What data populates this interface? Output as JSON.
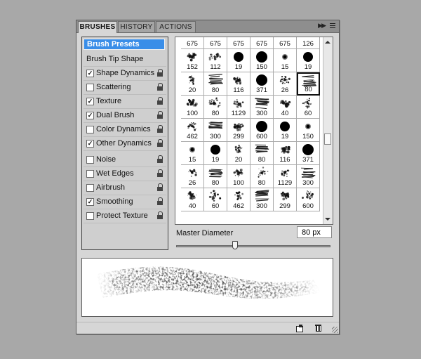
{
  "tabs": [
    {
      "label": "BRUSHES",
      "active": true
    },
    {
      "label": "HISTORY",
      "active": false
    },
    {
      "label": "ACTIONS",
      "active": false
    }
  ],
  "tab_controls": {
    "collapse_icon": "double-arrow-icon",
    "menu_icon": "panel-menu-icon"
  },
  "sidebar": {
    "preset_button": "Brush Presets",
    "tip_shape": "Brush Tip Shape",
    "options": [
      {
        "label": "Shape Dynamics",
        "checked": true,
        "locked": true
      },
      {
        "label": "Scattering",
        "checked": false,
        "locked": true
      },
      {
        "label": "Texture",
        "checked": true,
        "locked": true
      },
      {
        "label": "Dual Brush",
        "checked": true,
        "locked": true
      },
      {
        "label": "Color Dynamics",
        "checked": false,
        "locked": true
      },
      {
        "label": "Other Dynamics",
        "checked": true,
        "locked": true
      },
      {
        "label": "Noise",
        "checked": false,
        "locked": true
      },
      {
        "label": "Wet Edges",
        "checked": false,
        "locked": true
      },
      {
        "label": "Airbrush",
        "checked": false,
        "locked": true
      },
      {
        "label": "Smoothing",
        "checked": true,
        "locked": true
      },
      {
        "label": "Protect Texture",
        "checked": false,
        "locked": true
      }
    ]
  },
  "brush_grid": {
    "selected_index": 17,
    "sizes": [
      "675",
      "675",
      "675",
      "675",
      "675",
      "126",
      "152",
      "112",
      "19",
      "150",
      "15",
      "19",
      "20",
      "80",
      "116",
      "371",
      "26",
      "80",
      "100",
      "80",
      "1129",
      "300",
      "40",
      "60",
      "462",
      "300",
      "299",
      "600",
      "19",
      "150",
      "15",
      "19",
      "20",
      "80",
      "116",
      "371",
      "26",
      "80",
      "100",
      "80",
      "1129",
      "300",
      "40",
      "60",
      "462",
      "300",
      "299",
      "600"
    ],
    "styles": [
      "x",
      "x",
      "x",
      "x",
      "x",
      "x",
      "x",
      "x",
      "hard",
      "hard",
      "soft",
      "hard",
      "x",
      "x",
      "x",
      "hard",
      "x",
      "x",
      "x",
      "x",
      "x",
      "x",
      "x",
      "x",
      "x",
      "x",
      "x",
      "hard",
      "hard",
      "soft",
      "soft",
      "hard",
      "x",
      "x",
      "x",
      "hard",
      "x",
      "x",
      "x",
      "x",
      "x",
      "x",
      "x",
      "x",
      "x",
      "x",
      "x",
      "x"
    ]
  },
  "master_diameter": {
    "label": "Master Diameter",
    "value": "80 px",
    "slider_fraction": 0.38
  },
  "bottom_icons": [
    "new-preset-icon",
    "trash-icon"
  ]
}
